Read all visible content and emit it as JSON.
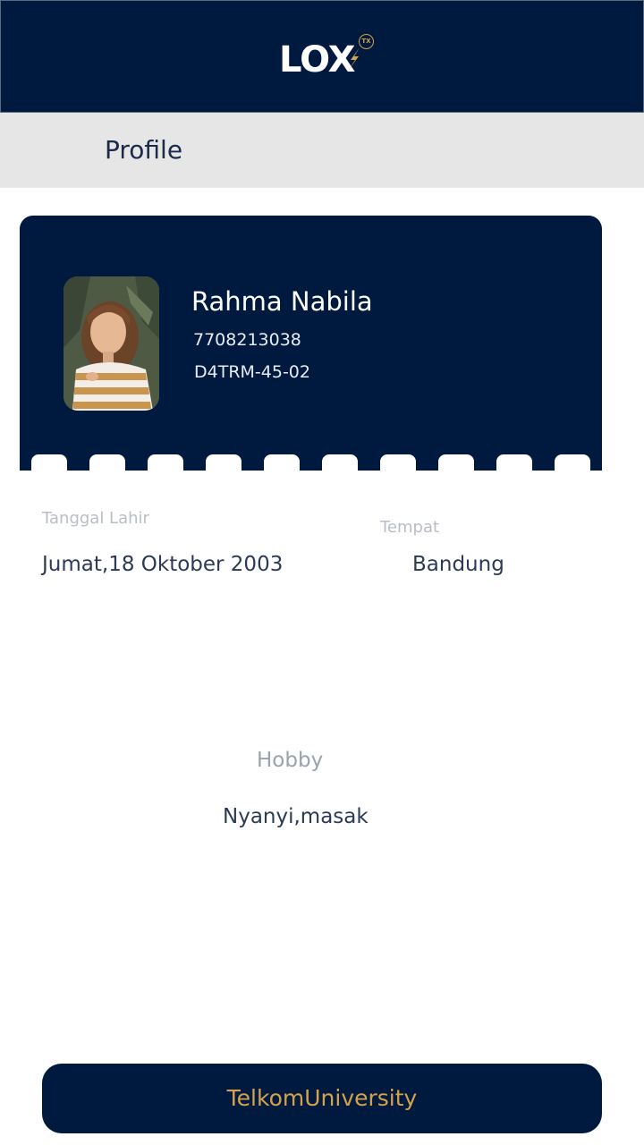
{
  "header": {
    "logo_text": "LOX",
    "logo_badge": "TX",
    "logo_icon": "lightning-spark-icon",
    "background_color": "#001a3f",
    "accent_color": "#d4a24c"
  },
  "page": {
    "title": "Profile"
  },
  "profile": {
    "name": "Rahma Nabila",
    "student_id": "7708213038",
    "class": "D4TRM-45-02",
    "avatar_icon": "profile-photo"
  },
  "details": {
    "birth_date_label": "Tanggal Lahir",
    "birth_date_value": "Jumat,18 Oktober 2003",
    "place_label": "Tempat",
    "place_value": "Bandung",
    "hobby_label": "Hobby",
    "hobby_value": "Nyanyi,masak"
  },
  "footer": {
    "label": "TelkomUniversity"
  }
}
